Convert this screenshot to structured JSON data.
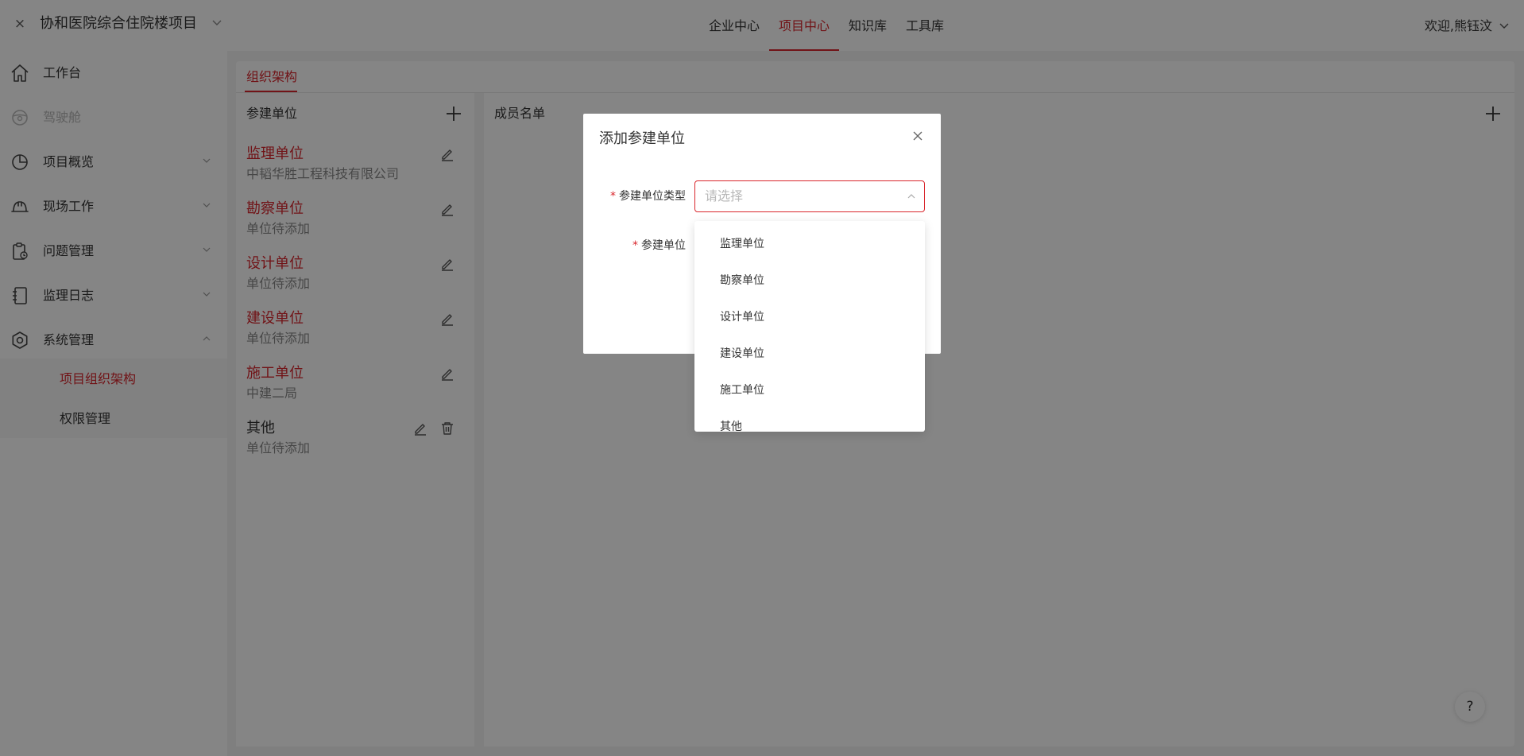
{
  "header": {
    "close_glyph": "×",
    "project_name": "协和医院综合住院楼项目",
    "nav_tabs": [
      {
        "label": "企业中心"
      },
      {
        "label": "项目中心"
      },
      {
        "label": "知识库"
      },
      {
        "label": "工具库"
      }
    ],
    "active_tab": "项目中心",
    "user_greeting": "欢迎,熊钰汶"
  },
  "sidebar": {
    "items": [
      {
        "label": "工作台",
        "icon": "home-icon",
        "expandable": false,
        "disabled": false
      },
      {
        "label": "驾驶舱",
        "icon": "steering-wheel-icon",
        "expandable": false,
        "disabled": true
      },
      {
        "label": "项目概览",
        "icon": "chart-pie-icon",
        "expandable": true,
        "disabled": false
      },
      {
        "label": "现场工作",
        "icon": "helmet-icon",
        "expandable": true,
        "disabled": false
      },
      {
        "label": "问题管理",
        "icon": "clipboard-icon",
        "expandable": true,
        "disabled": false
      },
      {
        "label": "监理日志",
        "icon": "notebook-icon",
        "expandable": true,
        "disabled": false
      },
      {
        "label": "系统管理",
        "icon": "settings-icon",
        "expandable": true,
        "disabled": false
      }
    ],
    "sub_items": [
      {
        "label": "项目组织架构",
        "active": true
      },
      {
        "label": "权限管理",
        "active": false
      }
    ]
  },
  "main": {
    "tab_label": "组织架构",
    "unit_panel_title": "参建单位",
    "member_panel_title": "成员名单",
    "units": [
      {
        "name": "监理单位",
        "org": "中韬华胜工程科技有限公司",
        "highlight": true
      },
      {
        "name": "勘察单位",
        "org": "单位待添加",
        "highlight": true
      },
      {
        "name": "设计单位",
        "org": "单位待添加",
        "highlight": true
      },
      {
        "name": "建设单位",
        "org": "单位待添加",
        "highlight": true
      },
      {
        "name": "施工单位",
        "org": "中建二局",
        "highlight": true
      },
      {
        "name": "其他",
        "org": "单位待添加",
        "highlight": false
      }
    ],
    "help_label": "?"
  },
  "modal": {
    "title": "添加参建单位",
    "required_mark": "*",
    "field_type_label": "参建单位类型",
    "field_unit_label": "参建单位",
    "select_placeholder": "请选择",
    "dropdown_options": [
      "监理单位",
      "勘察单位",
      "设计单位",
      "建设单位",
      "施工单位",
      "其他"
    ]
  },
  "colors": {
    "accent": "#d9262c",
    "text": "#333333",
    "muted": "#888888",
    "overlay": "rgba(0,0,0,0.48)"
  }
}
